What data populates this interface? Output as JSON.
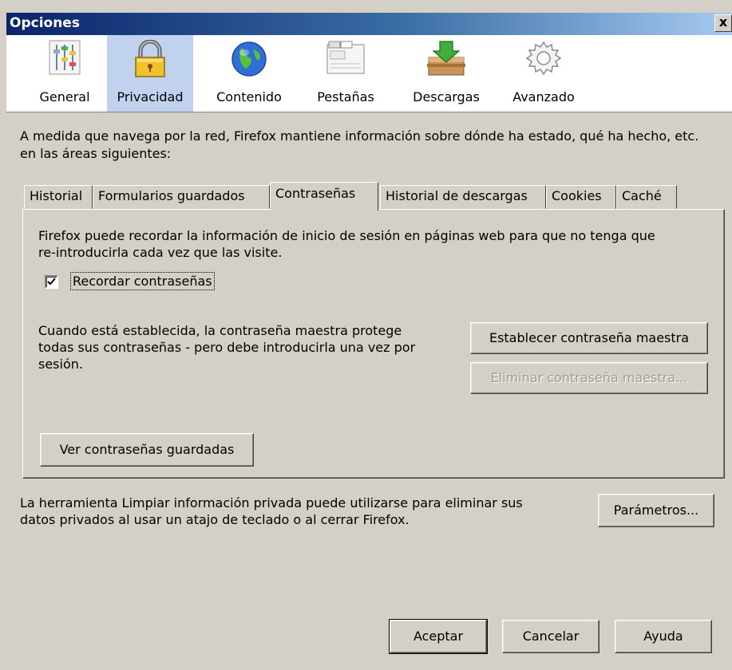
{
  "window": {
    "title": "Opciones",
    "close": "x"
  },
  "toolbar": {
    "items": [
      {
        "label": "General",
        "icon": "sliders-icon"
      },
      {
        "label": "Privacidad",
        "icon": "padlock-icon"
      },
      {
        "label": "Contenido",
        "icon": "globe-icon"
      },
      {
        "label": "Pestañas",
        "icon": "tabs-window-icon"
      },
      {
        "label": "Descargas",
        "icon": "download-box-icon"
      },
      {
        "label": "Avanzado",
        "icon": "gear-icon"
      }
    ],
    "selected": "Privacidad"
  },
  "intro": "A medida que navega por la red, Firefox mantiene información sobre dónde ha estado, qué ha hecho, etc. en las áreas siguientes:",
  "tabs": [
    "Historial",
    "Formularios guardados",
    "Contraseñas",
    "Historial de descargas",
    "Cookies",
    "Caché"
  ],
  "active_tab": "Contraseñas",
  "passwords": {
    "description_line1": "Firefox puede recordar la información de inicio de sesión en páginas web para que no tenga que",
    "description_line2": "re-introducirla cada vez que las visite.",
    "remember_label": "Recordar contraseñas",
    "remember_checked": true,
    "master_line1": "Cuando está establecida, la contraseña maestra protege",
    "master_line2": "todas sus contraseñas - pero debe introducirla una vez por",
    "master_line3": "sesión.",
    "set_master_button": "Establecer contraseña maestra",
    "remove_master_button": "Eliminar contraseña maestra...",
    "view_saved_button": "Ver contraseñas guardadas"
  },
  "clear_private": {
    "line1": "La herramienta Limpiar información privada puede utilizarse para eliminar sus",
    "line2": "datos privados al usar un atajo de teclado o al cerrar Firefox.",
    "settings_button": "Parámetros..."
  },
  "footer": {
    "ok": "Aceptar",
    "cancel": "Cancelar",
    "help": "Ayuda"
  },
  "colors": {
    "title_gradient_start": "#0a246a",
    "title_gradient_end": "#a6caf0",
    "selected_item": "#c1d2ee",
    "window_bg": "#d4d0c8"
  }
}
